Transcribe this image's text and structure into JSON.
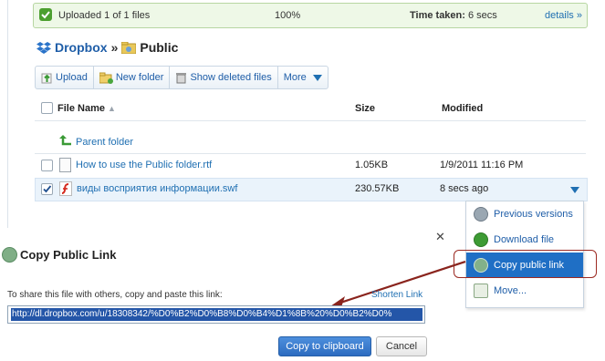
{
  "status": {
    "uploaded_text": "Uploaded 1 of 1 files",
    "percent": "100%",
    "time_label": "Time taken:",
    "time_value": "6 secs",
    "details_link": "details »"
  },
  "breadcrumb": {
    "root": "Dropbox",
    "separator": "»",
    "current": "Public"
  },
  "toolbar": {
    "upload": "Upload",
    "new_folder": "New folder",
    "show_deleted": "Show deleted files",
    "more": "More"
  },
  "table": {
    "headers": {
      "name": "File Name",
      "size": "Size",
      "modified": "Modified"
    },
    "parent_link": "Parent folder",
    "rows": [
      {
        "name": "How to use the Public folder.rtf",
        "size": "1.05KB",
        "modified": "1/9/2011 11:16 PM"
      },
      {
        "name": "виды восприятия информации.swf",
        "size": "230.57KB",
        "modified": "8 secs ago"
      }
    ]
  },
  "context_menu": {
    "items": [
      {
        "label": "Previous versions"
      },
      {
        "label": "Download file"
      },
      {
        "label": "Copy public link"
      },
      {
        "label": "Move..."
      }
    ]
  },
  "dialog": {
    "title": "Copy Public Link",
    "close": "✕",
    "instruction": "To share this file with others, copy and paste this link:",
    "shorten_link": "Shorten Link",
    "url": "http://dl.dropbox.com/u/18308342/%D0%B2%D0%B8%D0%B4%D1%8B%20%D0%B2%D0%",
    "copy_button": "Copy to clipboard",
    "cancel_button": "Cancel"
  },
  "colors": {
    "accent": "#1f6fb2",
    "highlight": "#1f6fc5",
    "annotation": "#9c2a22"
  }
}
